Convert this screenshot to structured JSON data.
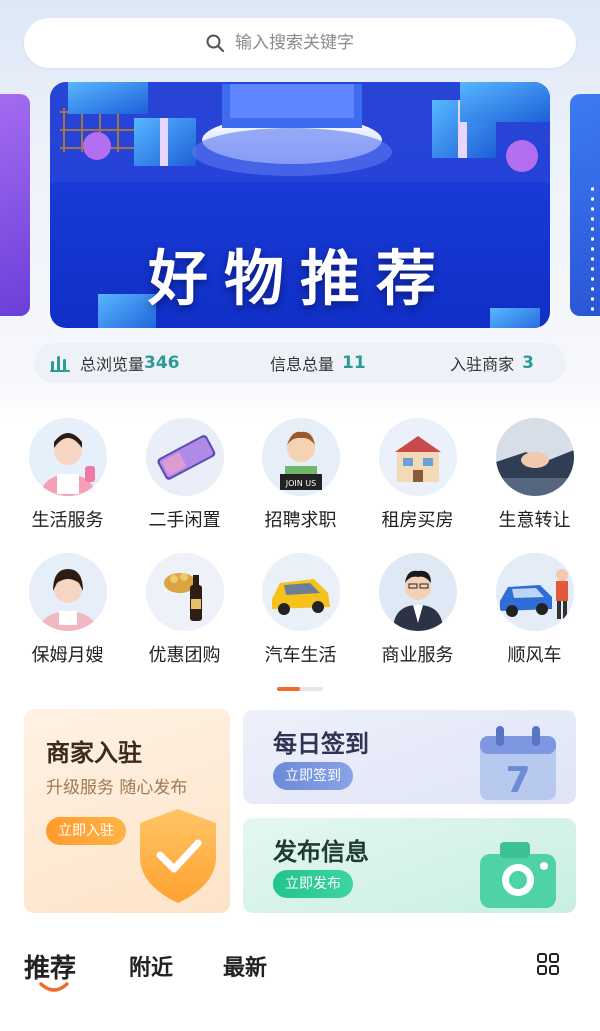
{
  "search": {
    "placeholder": "输入搜索关键字",
    "icon": "search-icon"
  },
  "banner": {
    "title": "好物推荐"
  },
  "stats": [
    {
      "label": "总浏览量",
      "value": "346"
    },
    {
      "label": "信息总量",
      "value": "11"
    },
    {
      "label": "入驻商家",
      "value": "3"
    }
  ],
  "categories": [
    {
      "label": "生活服务"
    },
    {
      "label": "二手闲置"
    },
    {
      "label": "招聘求职",
      "sign": "JOIN US"
    },
    {
      "label": "租房买房"
    },
    {
      "label": "生意转让"
    },
    {
      "label": "保姆月嫂"
    },
    {
      "label": "优惠团购"
    },
    {
      "label": "汽车生活"
    },
    {
      "label": "商业服务"
    },
    {
      "label": "顺风车"
    }
  ],
  "pager": {
    "current": 1,
    "total": 2
  },
  "promo": {
    "merchant": {
      "title": "商家入驻",
      "subtitle": "升级服务 随心发布",
      "button": "立即入驻"
    },
    "checkin": {
      "title": "每日签到",
      "button": "立即签到",
      "calendar_day": "7"
    },
    "publish": {
      "title": "发布信息",
      "button": "立即发布"
    }
  },
  "tabs": [
    {
      "label": "推荐",
      "active": true
    },
    {
      "label": "附近",
      "active": false
    },
    {
      "label": "最新",
      "active": false
    }
  ],
  "colors": {
    "accent_orange": "#f06a2a",
    "stat_number": "#2d9a95",
    "banner_blue": "#1a3ad6"
  }
}
